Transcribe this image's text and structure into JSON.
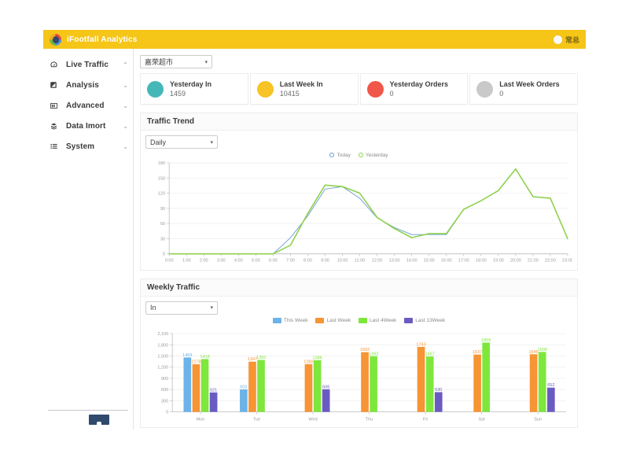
{
  "topbar": {
    "brand": "iFootfall Analytics",
    "user_name": "常总",
    "logo_icon": "app-logo-icon",
    "avatar_icon": "user-avatar-icon"
  },
  "sidebar": {
    "items": [
      {
        "label": "Live Traffic",
        "icon": "speedometer-icon",
        "caret": "⌃",
        "expanded": true
      },
      {
        "label": "Analysis",
        "icon": "note-icon",
        "caret": "⌄",
        "expanded": false
      },
      {
        "label": "Advanced",
        "icon": "columns-icon",
        "caret": "⌄",
        "expanded": false
      },
      {
        "label": "Data Imort",
        "icon": "database-icon",
        "caret": "⌄",
        "expanded": false
      },
      {
        "label": "System",
        "icon": "list-icon",
        "caret": "⌄",
        "expanded": false
      }
    ]
  },
  "store_filter": {
    "value": "嘉荣超市",
    "caret": "▾"
  },
  "cards": [
    {
      "title": "Yesterday In",
      "value": "1459",
      "color": "#45b7b8"
    },
    {
      "title": "Last Week In",
      "value": "10415",
      "color": "#f7c325"
    },
    {
      "title": "Yesterday Orders",
      "value": "0",
      "color": "#f0564a"
    },
    {
      "title": "Last Week Orders",
      "value": "0",
      "color": "#c9c9c9"
    }
  ],
  "traffic_trend": {
    "title": "Traffic Trend",
    "period_select": {
      "value": "Daily",
      "caret": "▾"
    }
  },
  "weekly_traffic": {
    "title": "Weekly Traffic",
    "direction_select": {
      "value": "In",
      "caret": "▾"
    }
  },
  "chart_data": [
    {
      "type": "line",
      "title": "Traffic Trend",
      "xlabel": "",
      "ylabel": "",
      "grid": true,
      "legend_position": "top-center",
      "ylim": [
        0,
        180
      ],
      "yticks": [
        0,
        30,
        60,
        90,
        120,
        150,
        180
      ],
      "categories": [
        "0:00",
        "1:00",
        "2:00",
        "3:00",
        "4:00",
        "5:00",
        "6:00",
        "7:00",
        "8:00",
        "9:00",
        "10:00",
        "11:00",
        "12:00",
        "13:00",
        "14:00",
        "15:00",
        "16:00",
        "17:00",
        "18:00",
        "19:00",
        "20:00",
        "21:00",
        "22:00",
        "23:00"
      ],
      "series": [
        {
          "name": "Today",
          "color": "#6b9bd2",
          "values": [
            0,
            0,
            0,
            0,
            0,
            0,
            0,
            32,
            75,
            128,
            133,
            110,
            71,
            52,
            38,
            38,
            38,
            88,
            null,
            null,
            null,
            null,
            null,
            null
          ]
        },
        {
          "name": "Yesterday",
          "color": "#8fd14f",
          "values": [
            0,
            0,
            0,
            0,
            0,
            0,
            0,
            17,
            80,
            136,
            133,
            120,
            72,
            50,
            32,
            40,
            40,
            88,
            105,
            125,
            168,
            113,
            110,
            30
          ]
        }
      ]
    },
    {
      "type": "bar",
      "title": "Weekly Traffic",
      "xlabel": "",
      "ylabel": "",
      "grid": true,
      "legend_position": "top-center",
      "ylim": [
        0,
        2100
      ],
      "yticks": [
        0,
        300,
        600,
        900,
        1200,
        1500,
        1800,
        2100
      ],
      "categories": [
        "Mon",
        "Tue",
        "Wed",
        "Thu",
        "Fri",
        "Sat",
        "Sun"
      ],
      "series": [
        {
          "name": "This Week",
          "color": "#6bb3e8",
          "values": [
            1459,
            603,
            null,
            null,
            null,
            null,
            null
          ]
        },
        {
          "name": "Last Week",
          "color": "#f79433",
          "values": [
            1278,
            1347,
            1280,
            1602,
            1743,
            1537,
            1546
          ]
        },
        {
          "name": "Last 4Week",
          "color": "#7ee73c",
          "values": [
            1418,
            1393,
            1386,
            1493,
            1487,
            1859,
            1608
          ]
        },
        {
          "name": "Last 13Week",
          "color": "#6a5bc2",
          "values": [
            521,
            null,
            606,
            null,
            530,
            null,
            652
          ]
        }
      ]
    }
  ]
}
